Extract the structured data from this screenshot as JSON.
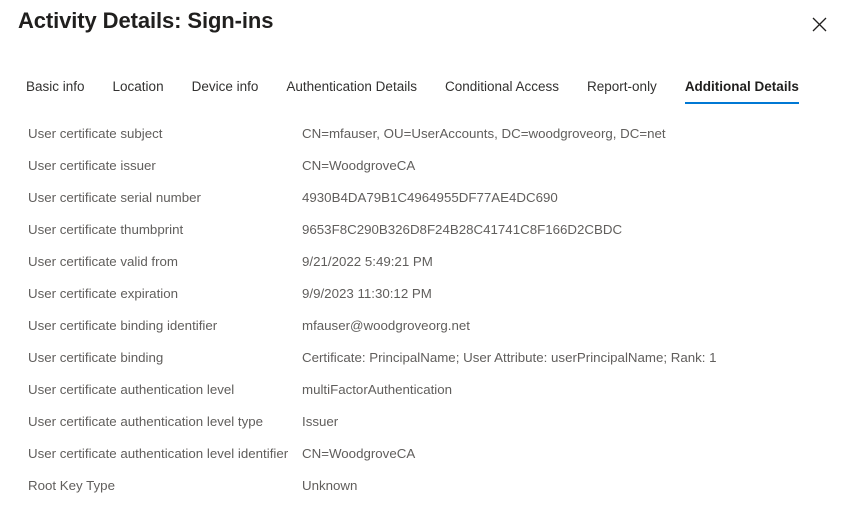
{
  "header": {
    "title": "Activity Details: Sign-ins",
    "close_icon": "close-icon",
    "close_label": "Close"
  },
  "tabs": [
    {
      "label": "Basic info",
      "active": false
    },
    {
      "label": "Location",
      "active": false
    },
    {
      "label": "Device info",
      "active": false
    },
    {
      "label": "Authentication Details",
      "active": false
    },
    {
      "label": "Conditional Access",
      "active": false
    },
    {
      "label": "Report-only",
      "active": false
    },
    {
      "label": "Additional Details",
      "active": true
    }
  ],
  "colors": {
    "accent": "#0078d4",
    "label_text": "#605e5c",
    "title_text": "#201f1e",
    "background": "#ffffff"
  },
  "details": {
    "rows": [
      {
        "label": "User certificate subject",
        "value": "CN=mfauser, OU=UserAccounts, DC=woodgroveorg, DC=net"
      },
      {
        "label": "User certificate issuer",
        "value": "CN=WoodgroveCA"
      },
      {
        "label": "User certificate serial number",
        "value": "4930B4DA79B1C4964955DF77AE4DC690"
      },
      {
        "label": "User certificate thumbprint",
        "value": "9653F8C290B326D8F24B28C41741C8F166D2CBDC"
      },
      {
        "label": "User certificate valid from",
        "value": "9/21/2022 5:49:21 PM"
      },
      {
        "label": "User certificate expiration",
        "value": "9/9/2023 11:30:12 PM"
      },
      {
        "label": "User certificate binding identifier",
        "value": "mfauser@woodgroveorg.net"
      },
      {
        "label": "User certificate binding",
        "value": "Certificate: PrincipalName; User Attribute: userPrincipalName; Rank: 1"
      },
      {
        "label": "User certificate authentication level",
        "value": "multiFactorAuthentication"
      },
      {
        "label": "User certificate authentication level type",
        "value": "Issuer"
      },
      {
        "label": "User certificate authentication level identifier",
        "value": "CN=WoodgroveCA"
      },
      {
        "label": "Root Key Type",
        "value": "Unknown"
      }
    ]
  }
}
